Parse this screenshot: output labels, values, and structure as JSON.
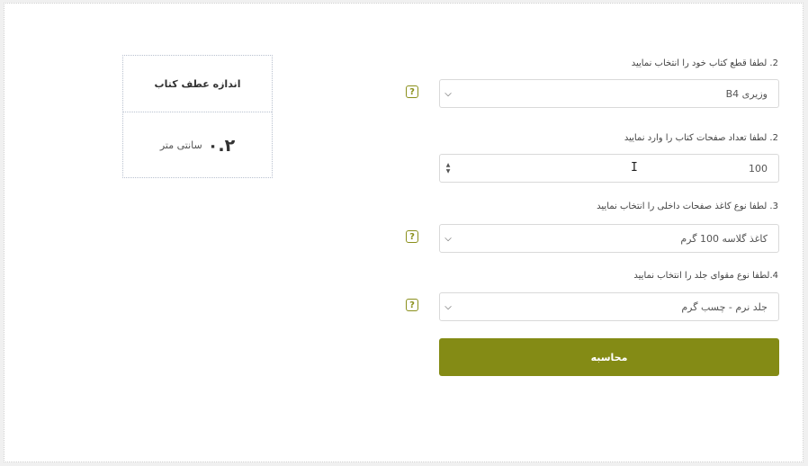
{
  "result": {
    "title": "اندازه عطف کتاب",
    "value": "۰.۲",
    "unit": "سانتی متر"
  },
  "form": {
    "q1_label": "2. لطفا قطع کتاب خود را انتخاب نمایید",
    "q1_value": "وزیری B4",
    "q2_label": "2. لطفا تعداد صفحات کتاب را وارد نمایید",
    "q2_value": "100",
    "q3_label": "3. لطفا نوع کاغذ صفحات داخلی را انتخاب نمایید",
    "q3_value": "کاغذ گلاسه 100 گرم",
    "q4_label": "4.لطفا نوع مقوای جلد را انتخاب نمایید",
    "q4_value": "جلد نرم - چسب گرم",
    "help_glyph": "?",
    "submit_label": "محاسبه"
  },
  "icons": {
    "chevron": "chevron-down-icon",
    "spinner": "number-spinner-icon",
    "help": "help-icon",
    "cursor": "text-cursor-icon"
  },
  "colors": {
    "accent": "#848b15",
    "help_border": "#8a8f1b"
  }
}
